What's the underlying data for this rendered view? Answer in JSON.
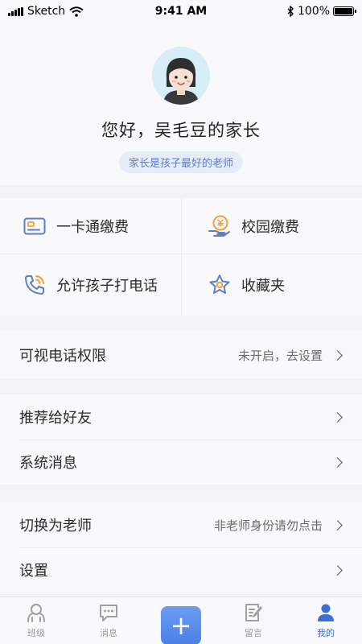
{
  "status_bar": {
    "carrier": "Sketch",
    "time": "9:41 AM",
    "battery": "100%"
  },
  "profile": {
    "greeting": "您好，吴毛豆的家长",
    "motto": "家长是孩子最好的老师"
  },
  "shortcuts": [
    {
      "label": "一卡通缴费",
      "icon": "card-icon"
    },
    {
      "label": "校园缴费",
      "icon": "yuan-payment-icon"
    },
    {
      "label": "允许孩子打电话",
      "icon": "phone-icon"
    },
    {
      "label": "收藏夹",
      "icon": "star-icon"
    }
  ],
  "video_call": {
    "label": "可视电话权限",
    "status": "未开启，去设置"
  },
  "menu_group_1": [
    {
      "label": "推荐给好友"
    },
    {
      "label": "系统消息"
    }
  ],
  "menu_group_2": [
    {
      "label": "切换为老师",
      "hint": "非老师身份请勿点击"
    },
    {
      "label": "设置"
    }
  ],
  "tab_bar": {
    "tabs": [
      {
        "label": "班级",
        "icon": "class-icon"
      },
      {
        "label": "消息",
        "icon": "message-icon"
      },
      {
        "label": "+",
        "icon": "plus-icon"
      },
      {
        "label": "留言",
        "icon": "note-icon"
      },
      {
        "label": "我的",
        "icon": "user-icon"
      }
    ],
    "active": "我的"
  },
  "colors": {
    "accent": "#3a6fd8",
    "icon_blue": "#5b7ec8",
    "icon_orange": "#f0a23a",
    "background": "#f3f3f6"
  }
}
